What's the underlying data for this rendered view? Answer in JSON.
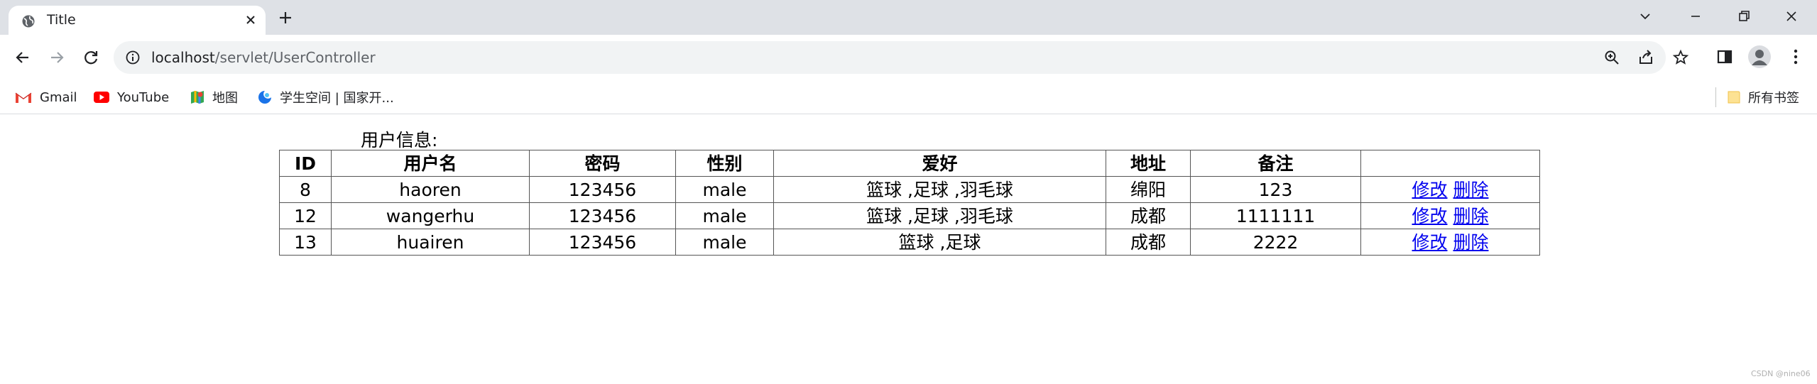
{
  "browser": {
    "tab_title": "Title",
    "url_host": "localhost",
    "url_path": "/servlet/UserController",
    "bookmarks": [
      {
        "label": "Gmail",
        "icon": "gmail-icon"
      },
      {
        "label": "YouTube",
        "icon": "youtube-icon"
      },
      {
        "label": "地图",
        "icon": "maps-icon"
      },
      {
        "label": "学生空间 | 国家开...",
        "icon": "student-space-icon"
      }
    ],
    "all_bookmarks_label": "所有书签"
  },
  "page": {
    "heading": "用户信息:",
    "table": {
      "headers": [
        "ID",
        "用户名",
        "密码",
        "性别",
        "爱好",
        "地址",
        "备注",
        ""
      ],
      "rows": [
        {
          "id": "8",
          "username": "haoren",
          "password": "123456",
          "gender": "male",
          "hobby": "篮球 ,足球 ,羽毛球",
          "address": "绵阳",
          "note": "123",
          "edit": "修改",
          "delete": "删除"
        },
        {
          "id": "12",
          "username": "wangerhu",
          "password": "123456",
          "gender": "male",
          "hobby": "篮球 ,足球 ,羽毛球",
          "address": "成都",
          "note": "1111111",
          "edit": "修改",
          "delete": "删除"
        },
        {
          "id": "13",
          "username": "huairen",
          "password": "123456",
          "gender": "male",
          "hobby": "篮球 ,足球",
          "address": "成都",
          "note": "2222",
          "edit": "修改",
          "delete": "删除"
        }
      ]
    },
    "watermark": "CSDN @nine06"
  },
  "colors": {
    "tabstrip_bg": "#dee1e6",
    "omnibox_bg": "#f1f3f4",
    "link": "#0000ee"
  }
}
